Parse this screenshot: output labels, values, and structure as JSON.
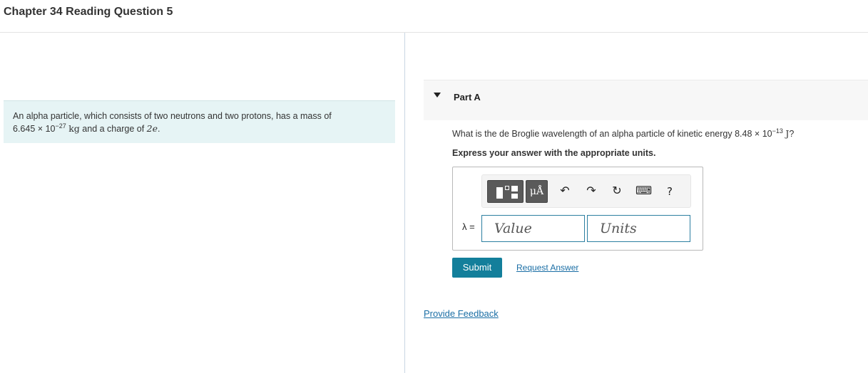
{
  "header": {
    "title": "Chapter 34 Reading Question 5"
  },
  "intro": {
    "text_before_mass": "An alpha particle, which consists of two neutrons and two protons, has a mass of",
    "mass_mantissa": "6.645",
    "times": "×",
    "mass_base": "10",
    "mass_exponent": "−27",
    "mass_unit": "kg",
    "text_before_charge": "and a charge of",
    "charge": "2e",
    "period": "."
  },
  "part": {
    "label": "Part A"
  },
  "question": {
    "text": "What is the de Broglie wavelength of an alpha particle of kinetic energy",
    "energy_mantissa": "8.48",
    "times": "×",
    "energy_base": "10",
    "energy_exponent": "−13",
    "energy_unit": "J",
    "end": "?"
  },
  "instruction": "Express your answer with the appropriate units.",
  "toolbar": {
    "unit_symbol": "μÅ",
    "undo_icon": "↶",
    "redo_icon": "↷",
    "reset_icon": "↻",
    "keyboard_icon": "⌨",
    "help_label": "?"
  },
  "answer": {
    "variable_label": "λ =",
    "value_placeholder": "Value",
    "units_placeholder": "Units"
  },
  "buttons": {
    "submit": "Submit",
    "request_answer": "Request Answer"
  },
  "feedback_link": "Provide Feedback",
  "colors": {
    "accent": "#137f9b",
    "link": "#1a6ea5",
    "intro_bg": "#e6f4f5"
  }
}
